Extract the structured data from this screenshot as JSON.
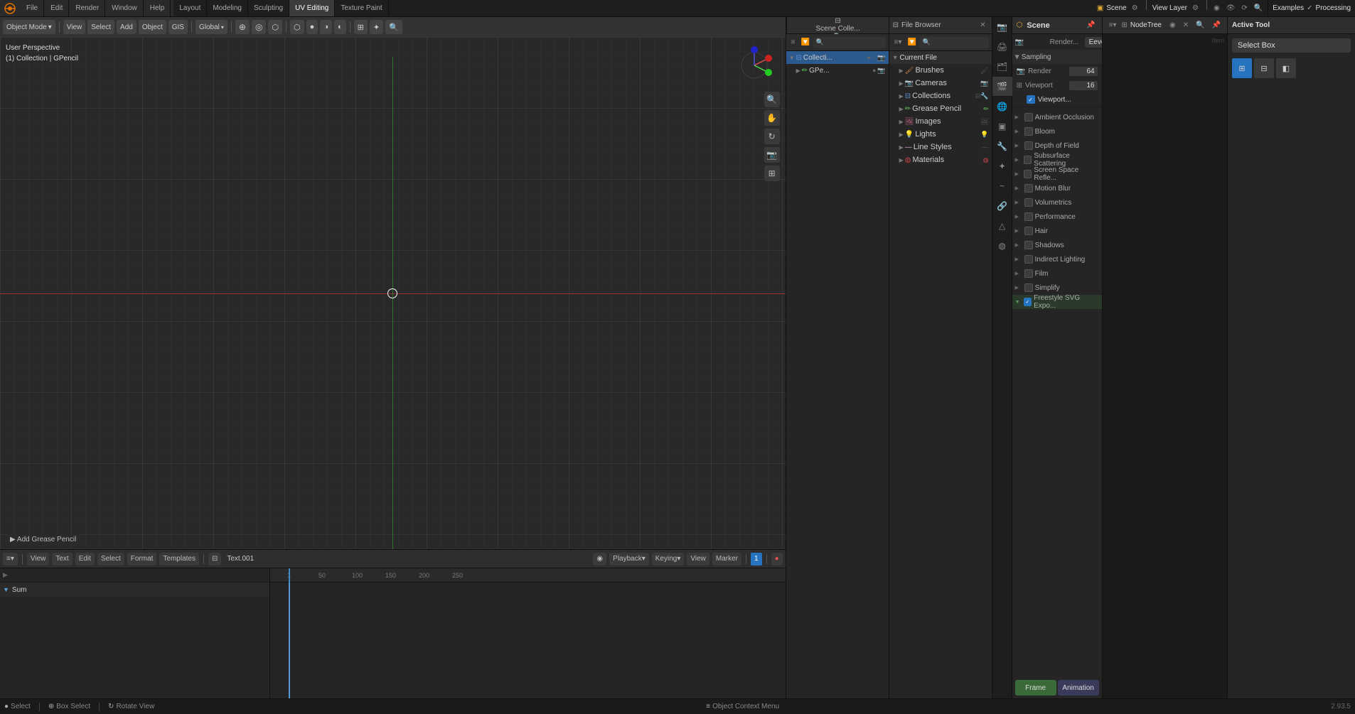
{
  "app": {
    "title": "Blender"
  },
  "top_menu": {
    "items": [
      {
        "label": "File",
        "id": "file"
      },
      {
        "label": "Edit",
        "id": "edit"
      },
      {
        "label": "Render",
        "id": "render"
      },
      {
        "label": "Window",
        "id": "window"
      },
      {
        "label": "Help",
        "id": "help"
      }
    ]
  },
  "workspace_tabs": [
    {
      "label": "Layout",
      "id": "layout",
      "active": false
    },
    {
      "label": "Modeling",
      "id": "modeling",
      "active": false
    },
    {
      "label": "Sculpting",
      "id": "sculpting",
      "active": false
    },
    {
      "label": "UV Editing",
      "id": "uv-editing",
      "active": true
    },
    {
      "label": "Texture Paint",
      "id": "texture-paint",
      "active": false
    }
  ],
  "viewport": {
    "mode": "Object Mode",
    "perspective_label": "User Perspective",
    "collection_label": "(1) Collection | GPencil",
    "transform_mode": "Global"
  },
  "scene_collection": {
    "title": "Scene Colle...",
    "items": [
      {
        "label": "Collecti...",
        "depth": 0,
        "type": "collection",
        "active": true
      },
      {
        "label": "GPe...",
        "depth": 1,
        "type": "gpencil",
        "active": false
      }
    ]
  },
  "file_browser": {
    "title": "Current File",
    "items": [
      {
        "label": "Brushes",
        "type": "brush"
      },
      {
        "label": "Cameras",
        "type": "camera"
      },
      {
        "label": "Collections",
        "type": "collection"
      },
      {
        "label": "Grease Pencil",
        "type": "gpencil"
      },
      {
        "label": "Images",
        "type": "image"
      },
      {
        "label": "Lights",
        "type": "light"
      },
      {
        "label": "Line Styles",
        "type": "linestyle"
      },
      {
        "label": "Materials",
        "type": "material"
      }
    ]
  },
  "properties": {
    "scene_title": "Scene",
    "render_engine_label": "Render...",
    "render_engine": "Eevee",
    "sampling": {
      "title": "Sampling",
      "render_label": "Render",
      "render_value": "64",
      "viewport_label": "Viewport",
      "viewport_value": "16",
      "viewport_denoising": "Viewport..."
    },
    "sections": [
      {
        "label": "Ambient Occlusion",
        "enabled": false,
        "collapsed": true
      },
      {
        "label": "Bloom",
        "enabled": false,
        "collapsed": true
      },
      {
        "label": "Depth of Field",
        "enabled": false,
        "collapsed": true
      },
      {
        "label": "Subsurface Scattering",
        "enabled": false,
        "collapsed": true
      },
      {
        "label": "Screen Space Refle...",
        "enabled": false,
        "collapsed": true
      },
      {
        "label": "Motion Blur",
        "enabled": false,
        "collapsed": true
      },
      {
        "label": "Volumetrics",
        "enabled": false,
        "collapsed": true
      },
      {
        "label": "Performance",
        "enabled": false,
        "collapsed": true
      },
      {
        "label": "Hair",
        "enabled": false,
        "collapsed": true
      },
      {
        "label": "Shadows",
        "enabled": false,
        "collapsed": true
      },
      {
        "label": "Indirect Lighting",
        "enabled": false,
        "collapsed": true
      },
      {
        "label": "Film",
        "enabled": false,
        "collapsed": true
      },
      {
        "label": "Simplify",
        "enabled": false,
        "collapsed": true
      },
      {
        "label": "Freestyle SVG Expo...",
        "enabled": true,
        "collapsed": true
      }
    ],
    "buttons": {
      "frame_label": "Frame",
      "animation_label": "Animation"
    }
  },
  "view_layer": {
    "title": "View Layer"
  },
  "nodetree": {
    "title": "NodeTree",
    "corner_label": "Item"
  },
  "active_tool": {
    "title": "Active Tool",
    "tool_name": "Select Box"
  },
  "timeline": {
    "title": "Text.001",
    "playback_label": "Playback",
    "keying_label": "Keying",
    "view_label": "View",
    "marker_label": "Marker",
    "current_frame": "1",
    "ruler_marks": [
      "1",
      "50",
      "100",
      "150",
      "200",
      "250"
    ],
    "sum_label": "Sum"
  },
  "bottom_menu": {
    "items": [
      {
        "label": "View",
        "id": "view"
      },
      {
        "label": "Text",
        "id": "text"
      },
      {
        "label": "Edit",
        "id": "edit"
      },
      {
        "label": "Select",
        "id": "select"
      },
      {
        "label": "Format",
        "id": "format"
      },
      {
        "label": "Templates",
        "id": "templates"
      }
    ]
  },
  "status_bar": {
    "select_label": "Select",
    "box_select_label": "Box Select",
    "rotate_view_label": "Rotate View",
    "context_menu_label": "Object Context Menu",
    "coords": "2.93.5"
  }
}
